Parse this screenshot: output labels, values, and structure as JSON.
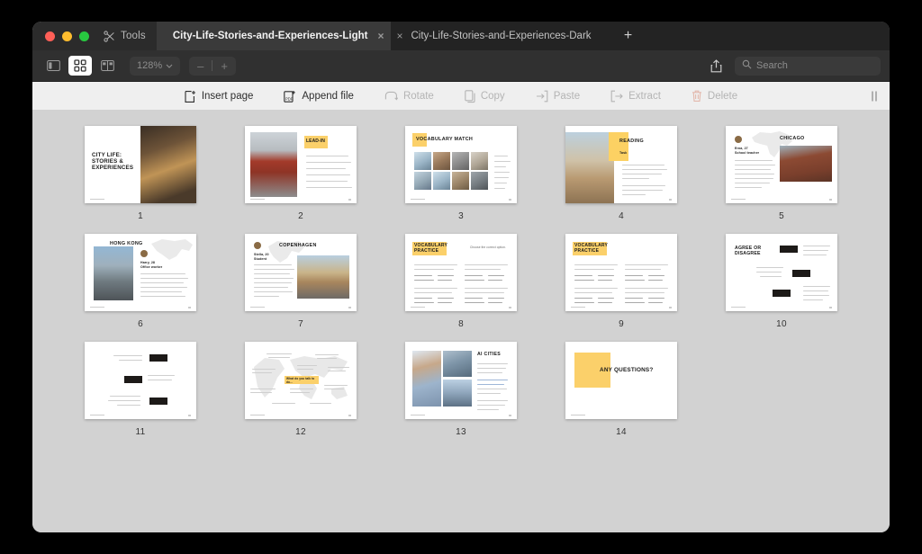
{
  "window": {
    "tools_label": "Tools",
    "tabs": [
      {
        "title": "City-Life-Stories-and-Experiences-Light",
        "active": true,
        "close": "×"
      },
      {
        "title": "City-Life-Stories-and-Experiences-Dark",
        "active": false,
        "close": "×"
      }
    ],
    "new_tab_label": "+"
  },
  "toolbar": {
    "view_sidebar_icon": "sidebar-icon",
    "grid_view_icon": "grid-view-icon",
    "split_view_icon": "split-view-icon",
    "zoom_level": "128%",
    "zoom_out_label": "–",
    "zoom_in_label": "+",
    "share_icon": "share-icon",
    "search_placeholder": "Search"
  },
  "actions": [
    {
      "label": "Insert page",
      "icon": "insert-page-icon",
      "disabled": false
    },
    {
      "label": "Append file",
      "icon": "append-file-icon",
      "disabled": false
    },
    {
      "label": "Rotate",
      "icon": "rotate-icon",
      "disabled": true
    },
    {
      "label": "Copy",
      "icon": "copy-icon",
      "disabled": true
    },
    {
      "label": "Paste",
      "icon": "paste-icon",
      "disabled": true
    },
    {
      "label": "Extract",
      "icon": "extract-icon",
      "disabled": true
    },
    {
      "label": "Delete",
      "icon": "delete-icon",
      "disabled": true
    }
  ],
  "colors": {
    "accent_yellow": "#fcd163",
    "dark_badge": "#1d1a18",
    "window_bg": "#d2d2d2",
    "tabbar_bg": "#2b2b2b",
    "toolbar_bg": "#303030",
    "actionbar_bg": "#efefef"
  },
  "document": {
    "page_count": 14,
    "pages": [
      {
        "number": "1",
        "title": "CITY LIFE: STORIES & EXPERIENCES",
        "layout": "title-photo-right"
      },
      {
        "number": "2",
        "title": "LEAD-IN",
        "layout": "photo-left-bullets-right"
      },
      {
        "number": "3",
        "title": "VOCABULARY MATCH",
        "layout": "photo-grid-wordlist"
      },
      {
        "number": "4",
        "title": "READING",
        "subtitle": "Task",
        "layout": "photo-left-text-right"
      },
      {
        "number": "5",
        "title": "CHICAGO",
        "person": "Erna, 27",
        "role": "School teacher",
        "layout": "profile-map-photo-right"
      },
      {
        "number": "6",
        "title": "HONG KONG",
        "person": "Harry, 28",
        "role": "Office worker",
        "layout": "photo-left-profile-map"
      },
      {
        "number": "7",
        "title": "COPENHAGEN",
        "person": "Stella, 20",
        "role": "Student",
        "layout": "profile-map-photo-right"
      },
      {
        "number": "8",
        "title": "VOCABULARY PRACTICE",
        "instruction": "Choose the correct option.",
        "layout": "two-column-questions"
      },
      {
        "number": "9",
        "title": "VOCABULARY PRACTICE",
        "layout": "two-column-questions"
      },
      {
        "number": "10",
        "title": "AGREE OR DISAGREE",
        "layout": "numbered-statements"
      },
      {
        "number": "11",
        "title": "",
        "layout": "numbered-statements"
      },
      {
        "number": "12",
        "title": "",
        "center_label": "What do you talk to do...",
        "layout": "world-map-discussion"
      },
      {
        "number": "13",
        "title": "AI CITIES",
        "layout": "image-collage-text"
      },
      {
        "number": "14",
        "title": "ANY QUESTIONS?",
        "layout": "closing"
      }
    ]
  }
}
